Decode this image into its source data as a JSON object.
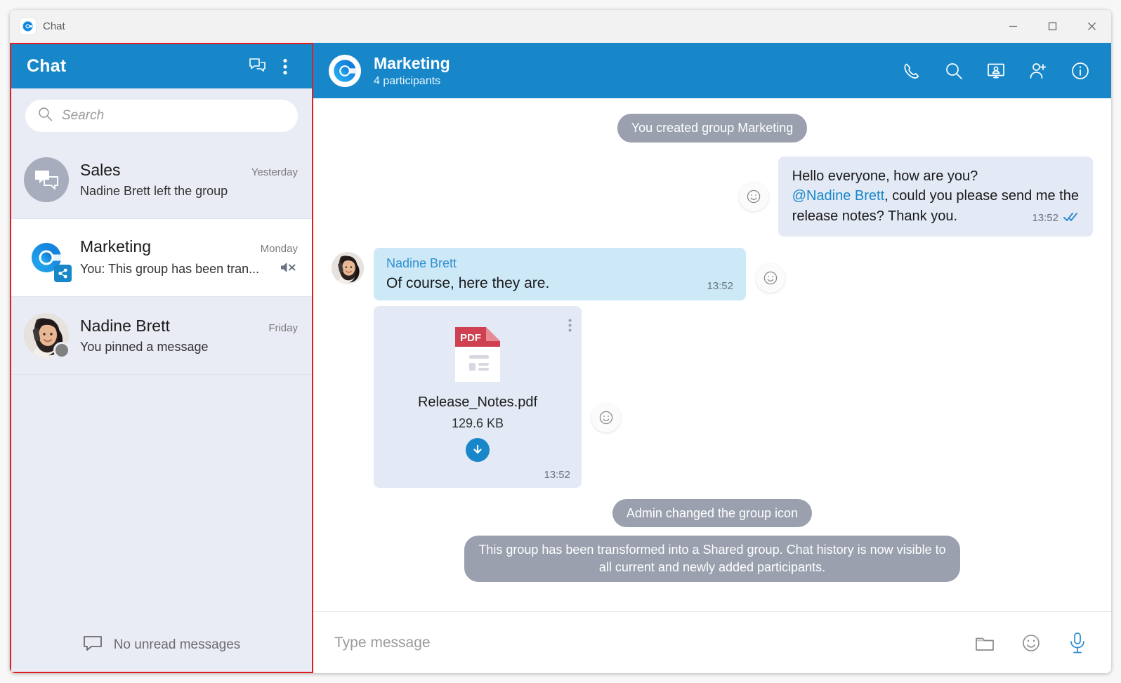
{
  "window": {
    "title": "Chat",
    "app_icon": "app-logo-icon",
    "minimize_label": "Minimize",
    "maximize_label": "Maximize",
    "close_label": "Close",
    "accent_color": "#1787c9",
    "selection_outline_color": "#e02020"
  },
  "sidebar": {
    "header_title": "Chat",
    "new_chat_icon": "new-chat-icon",
    "more_options_icon": "more-options-icon",
    "search": {
      "placeholder": "Search",
      "value": "",
      "icon": "search-icon"
    },
    "items": [
      {
        "name": "Sales",
        "time": "Yesterday",
        "preview": "Nadine Brett left the group",
        "avatar_type": "group-bubbles",
        "active": false,
        "muted": false,
        "status": null
      },
      {
        "name": "Marketing",
        "time": "Monday",
        "preview": "You: This group has been tran...",
        "avatar_type": "brand-logo",
        "active": true,
        "muted": true,
        "mute_icon": "mute-icon",
        "badge": "share-badge-icon",
        "status": null
      },
      {
        "name": "Nadine Brett",
        "time": "Friday",
        "preview": "You pinned a message",
        "avatar_type": "photo",
        "active": false,
        "muted": false,
        "status": "offline"
      }
    ],
    "footer": {
      "icon": "chat-bubble-icon",
      "text": "No unread messages"
    }
  },
  "chat": {
    "header": {
      "title": "Marketing",
      "subtitle": "4 participants",
      "avatar": "brand-logo-icon",
      "icons": [
        {
          "name": "call-icon",
          "label": "Call"
        },
        {
          "name": "search-icon",
          "label": "Search in chat"
        },
        {
          "name": "screen-share-icon",
          "label": "Share screen"
        },
        {
          "name": "add-person-icon",
          "label": "Add participant"
        },
        {
          "name": "info-icon",
          "label": "Chat info"
        }
      ]
    },
    "messages": [
      {
        "type": "system",
        "text": "You created group Marketing"
      },
      {
        "type": "outgoing",
        "line1": "Hello everyone, how are you?",
        "mention": "@Nadine Brett",
        "line2_rest": ", could you please send me the",
        "line3": "release notes? Thank you.",
        "time": "13:52",
        "status": "read",
        "react_icon": "emoji-reaction-icon"
      },
      {
        "type": "incoming",
        "sender": "Nadine Brett",
        "text": "Of course, here they are.",
        "time": "13:52",
        "react_icon": "emoji-reaction-icon"
      },
      {
        "type": "file",
        "file_name": "Release_Notes.pdf",
        "file_size": "129.6 KB",
        "file_kind": "PDF",
        "time": "13:52",
        "menu_icon": "more-options-icon",
        "download_icon": "download-icon",
        "react_icon": "emoji-reaction-icon"
      },
      {
        "type": "system",
        "text": "Admin changed the group icon"
      },
      {
        "type": "system",
        "text": "This group has been transformed into a Shared group. Chat history is now visible to all current and newly added participants."
      }
    ],
    "composer": {
      "placeholder": "Type message",
      "value": "",
      "icons": [
        {
          "name": "attach-file-icon",
          "label": "Attach file"
        },
        {
          "name": "emoji-icon",
          "label": "Emoji"
        },
        {
          "name": "microphone-icon",
          "label": "Voice message"
        }
      ]
    }
  }
}
